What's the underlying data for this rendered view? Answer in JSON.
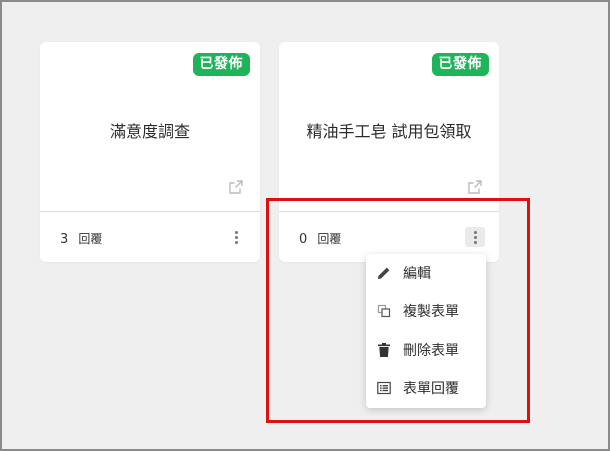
{
  "forms": [
    {
      "status_badge": "已發佈",
      "title": "滿意度調查",
      "reply_count": "3",
      "reply_label": "回覆"
    },
    {
      "status_badge": "已發佈",
      "title": "精油手工皂 試用包領取",
      "reply_count": "0",
      "reply_label": "回覆"
    }
  ],
  "context_menu": {
    "items": [
      {
        "label": "編輯",
        "icon": "pencil-icon"
      },
      {
        "label": "複製表單",
        "icon": "copy-icon"
      },
      {
        "label": "刪除表單",
        "icon": "trash-icon"
      },
      {
        "label": "表單回覆",
        "icon": "list-icon"
      }
    ]
  },
  "colors": {
    "badge_green": "#1fb35a",
    "highlight_red": "#e01010",
    "background": "#efefef"
  }
}
